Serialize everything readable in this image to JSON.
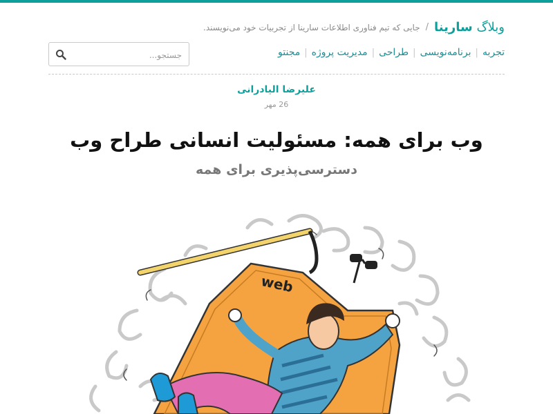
{
  "header": {
    "brand_prefix": "وبلاگ",
    "brand_name": "سارینا",
    "separator": "/",
    "tagline": "جایی که تیم فناوری اطلاعات سارینا از تجربیات خود می‌نویسند."
  },
  "nav": {
    "items": [
      {
        "label": "تجربه"
      },
      {
        "label": "برنامه‌نویسی"
      },
      {
        "label": "طراحی"
      },
      {
        "label": "مدیریت پروژه"
      },
      {
        "label": "مجنتو"
      }
    ],
    "separator": "|"
  },
  "search": {
    "placeholder": "جستجو...",
    "value": "",
    "icon": "search-icon"
  },
  "post": {
    "author": "علیرضا الیادرانی",
    "date": "26 مهر",
    "title": "وب برای همه: مسئولیت انسانی طراح وب",
    "subtitle": "دسترسی‌پذیری برای همه"
  },
  "illustration": {
    "carpet_label": "web"
  },
  "colors": {
    "accent": "#0e9f9a",
    "nav_link": "#1c8d95",
    "title": "#111111",
    "subtitle": "#777777",
    "carpet": "#f5a340",
    "shirt_stripe": "#4fa3c9",
    "pants": "#e36fb2"
  }
}
